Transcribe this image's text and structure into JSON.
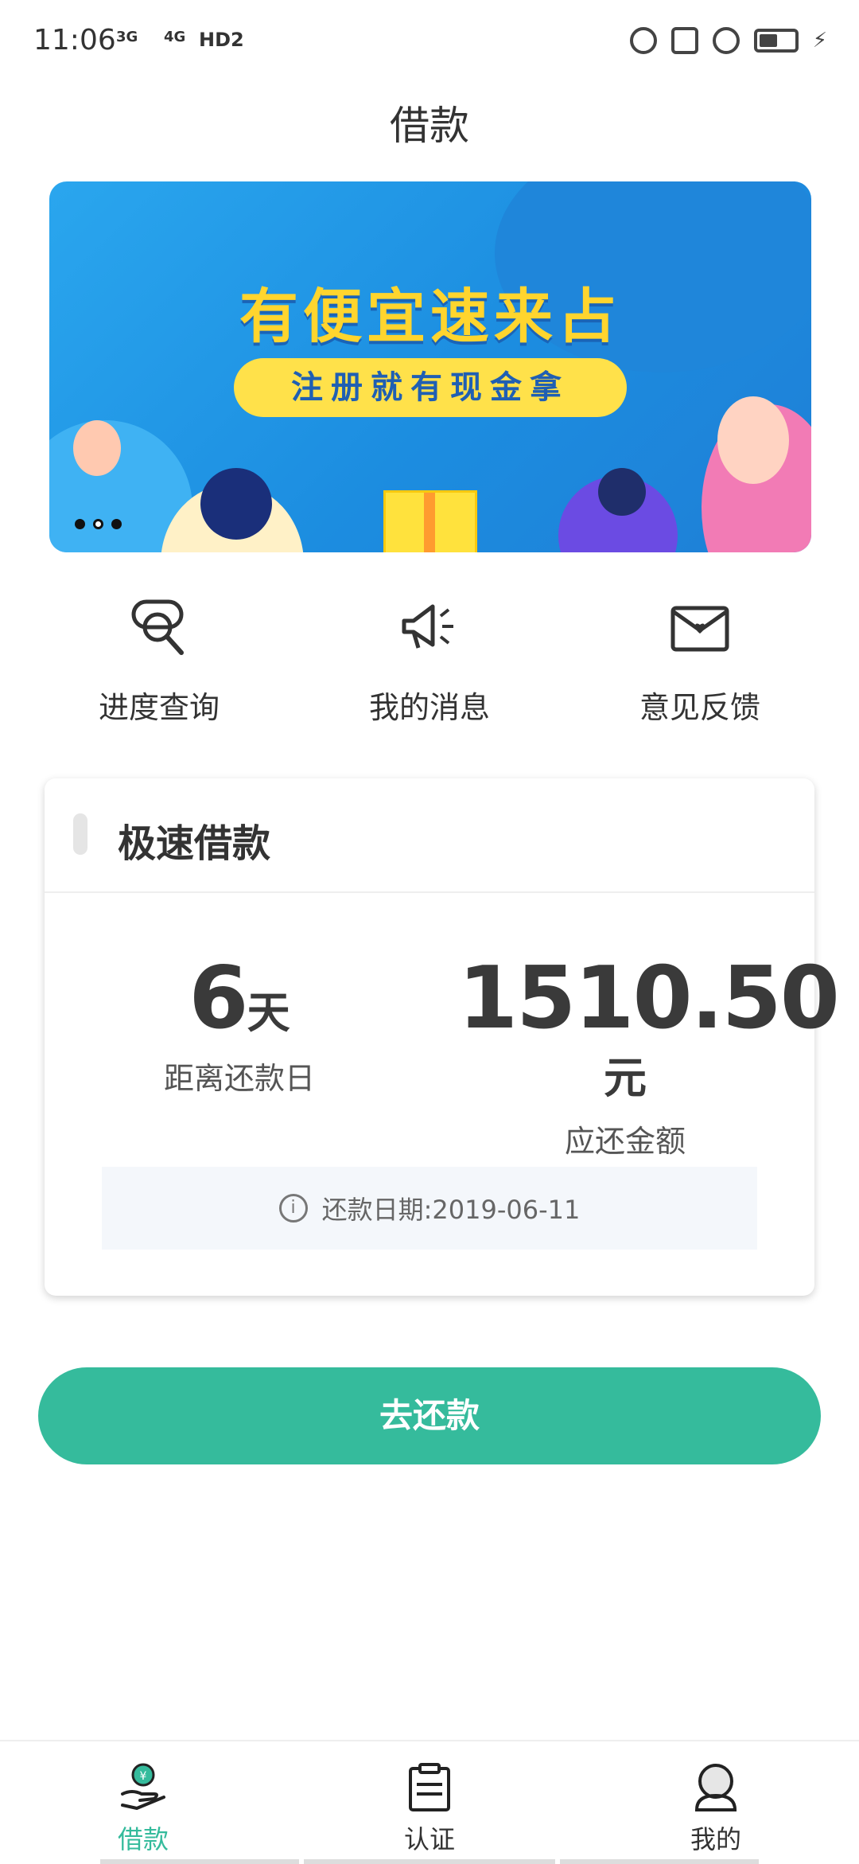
{
  "status_bar": {
    "time": "11:06",
    "network_1": "3G",
    "network_2": "4G",
    "hd": "HD2"
  },
  "header": {
    "title": "借款"
  },
  "banner": {
    "headline": "有便宜速来占",
    "tagline": "注册就有现金拿",
    "page_count": 3,
    "active_page": 1
  },
  "quick_actions": [
    {
      "label": "进度查询",
      "icon": "search-progress-icon"
    },
    {
      "label": "我的消息",
      "icon": "megaphone-icon"
    },
    {
      "label": "意见反馈",
      "icon": "envelope-heart-icon"
    }
  ],
  "loan_card": {
    "title": "极速借款",
    "days_value": "6",
    "days_unit": "天",
    "days_label": "距离还款日",
    "amount_value": "1510.50",
    "amount_unit": "元",
    "amount_label": "应还金额",
    "notice": "还款日期:2019-06-11"
  },
  "repay_button": {
    "label": "去还款"
  },
  "bottom_nav": [
    {
      "label": "借款",
      "icon": "loan-hand-coin-icon",
      "active": true
    },
    {
      "label": "认证",
      "icon": "clipboard-icon",
      "active": false
    },
    {
      "label": "我的",
      "icon": "user-profile-icon",
      "active": false
    }
  ],
  "colors": {
    "accent": "#35bb9c",
    "banner_blue": "#1c8de0",
    "banner_yellow": "#ffd52e"
  }
}
